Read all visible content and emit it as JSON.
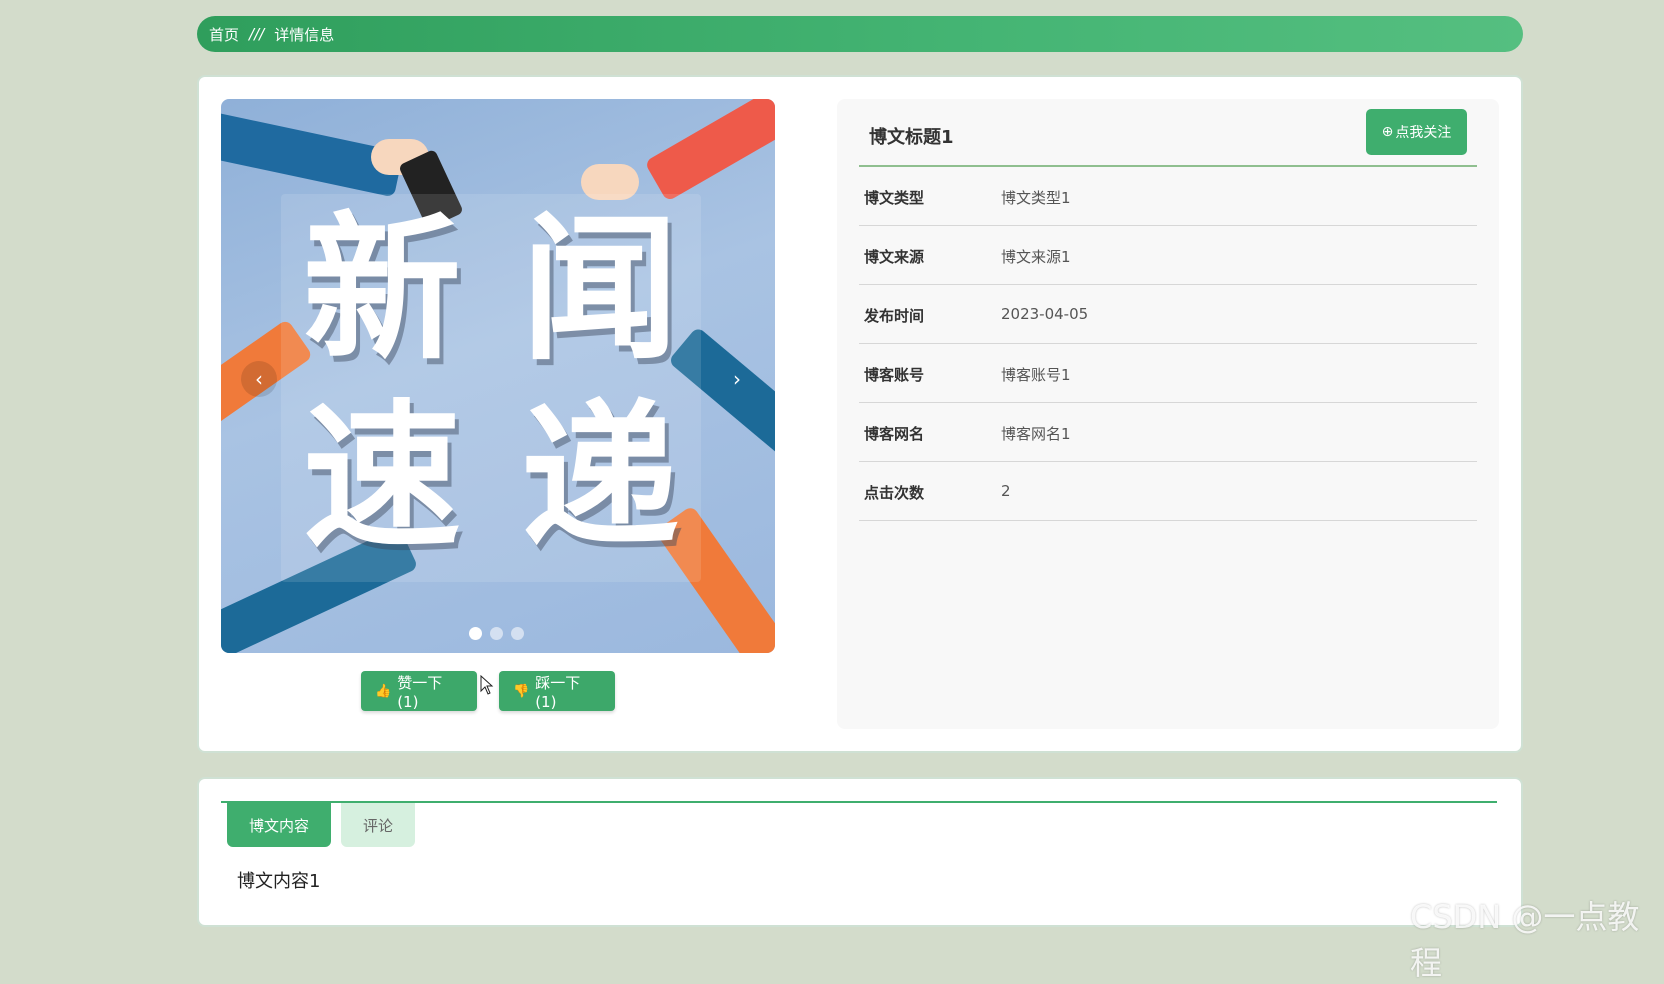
{
  "breadcrumb": {
    "home": "首页",
    "separator": "///",
    "current": "详情信息"
  },
  "carousel": {
    "chars": [
      "新",
      "闻",
      "速",
      "递"
    ],
    "prev_icon": "‹",
    "next_icon": "›",
    "slide_count": 3,
    "active_slide": 1
  },
  "votes": {
    "like_icon": "👍",
    "like_label": "赞一下(1)",
    "dislike_icon": "👎",
    "dislike_label": "踩一下(1)"
  },
  "detail": {
    "title": "博文标题1",
    "follow_icon": "⊕",
    "follow_label": "点我关注",
    "rows": [
      {
        "label": "博文类型",
        "value": "博文类型1"
      },
      {
        "label": "博文来源",
        "value": "博文来源1"
      },
      {
        "label": "发布时间",
        "value": "2023-04-05"
      },
      {
        "label": "博客账号",
        "value": "博客账号1"
      },
      {
        "label": "博客网名",
        "value": "博客网名1"
      },
      {
        "label": "点击次数",
        "value": "2"
      }
    ]
  },
  "tabs": {
    "content_tab": "博文内容",
    "comment_tab": "评论",
    "content_text": "博文内容1"
  },
  "watermark": "CSDN @一点教程",
  "colors": {
    "accent": "#3fae6e",
    "breadcrumb_start": "#2f9e5c",
    "background": "#d3dccb"
  }
}
